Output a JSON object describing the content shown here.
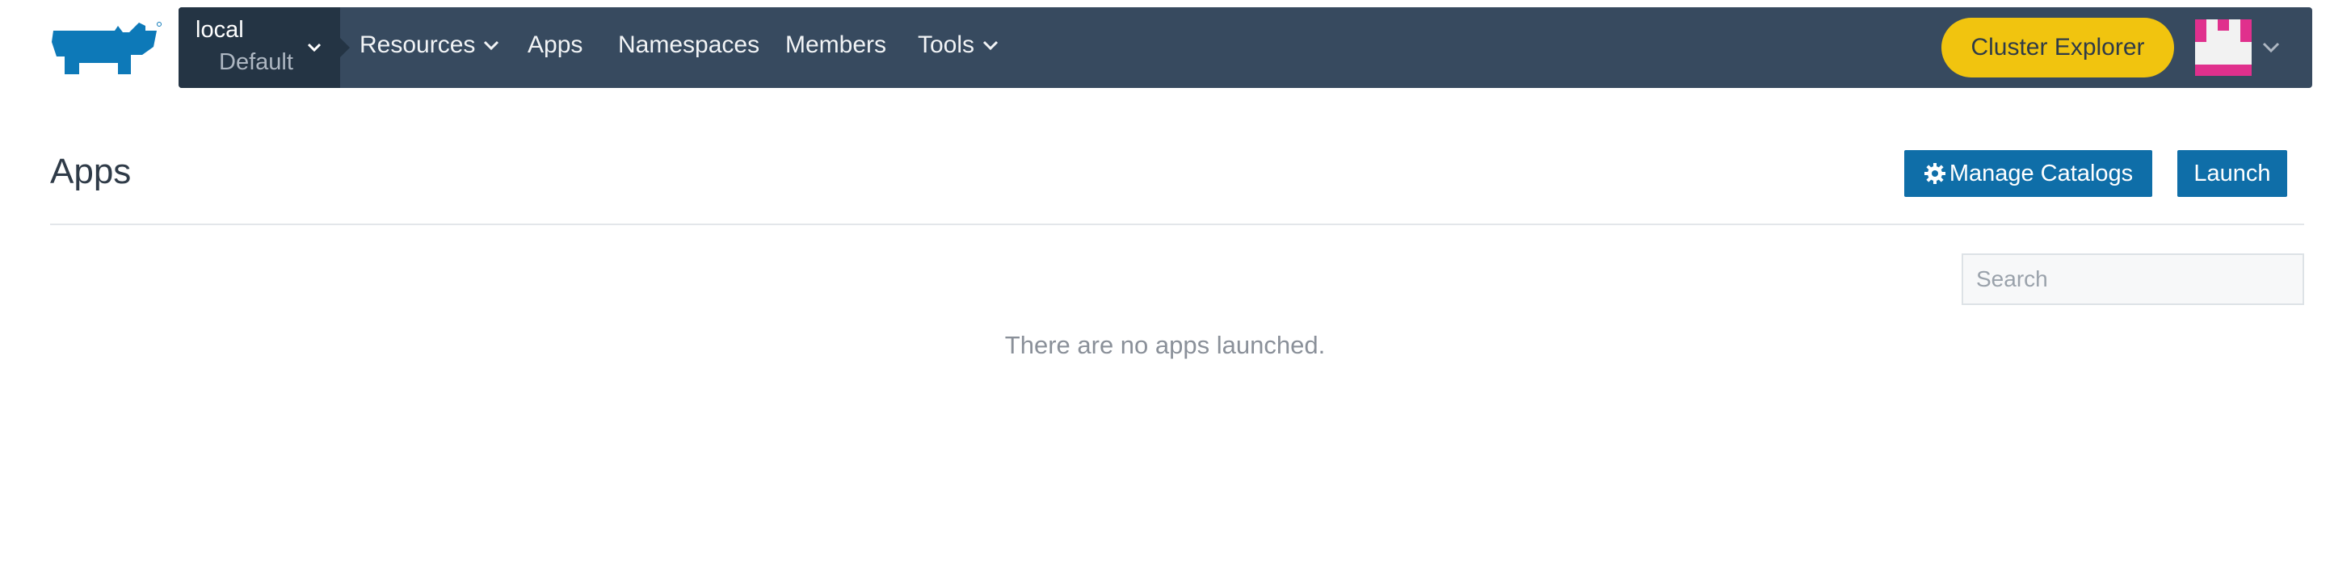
{
  "header": {
    "context": {
      "cluster": "local",
      "project": "Default"
    },
    "nav": {
      "resources": "Resources",
      "apps": "Apps",
      "namespaces": "Namespaces",
      "members": "Members",
      "tools": "Tools"
    },
    "cluster_explorer": "Cluster Explorer"
  },
  "page": {
    "title": "Apps",
    "manage_catalogs": "Manage Catalogs",
    "launch": "Launch",
    "search_placeholder": "Search",
    "empty_message": "There are no apps launched."
  },
  "colors": {
    "nav_bg": "#374a5f",
    "context_bg": "#243444",
    "primary": "#0f6ea8",
    "explorer": "#f1c40f",
    "logo": "#0d79b8",
    "avatar_accent": "#e0308d"
  },
  "icons": [
    "rancher-logo",
    "chevron-down-icon",
    "gear-icon",
    "user-avatar"
  ]
}
